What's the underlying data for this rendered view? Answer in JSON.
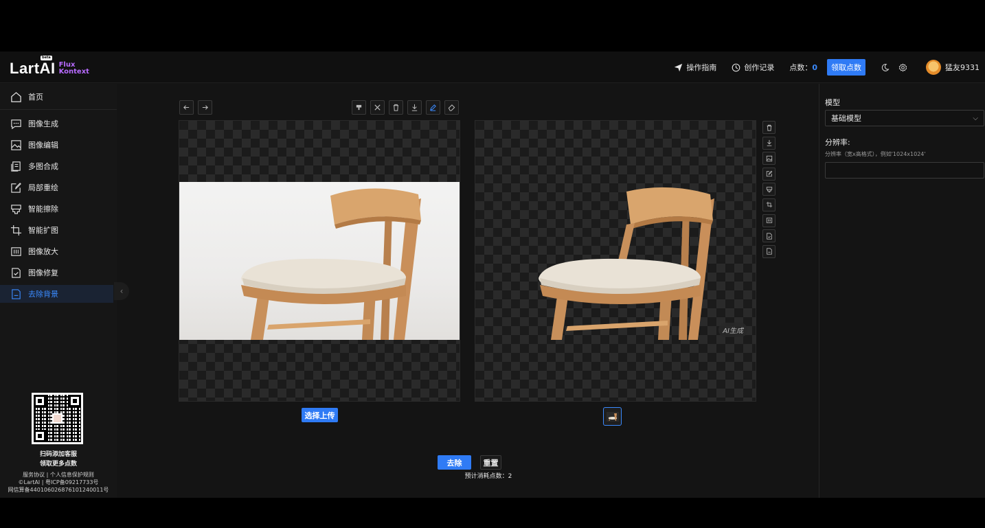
{
  "header": {
    "logo_text": "LartAI",
    "logo_badge": "beta",
    "logo_sub_line1": "Flux",
    "logo_sub_line2": "Kontext",
    "guide_label": "操作指南",
    "history_label": "创作记录",
    "points_label": "点数：",
    "points_value": "0",
    "claim_button": "领取点数",
    "username": "猛友9331"
  },
  "sidebar": {
    "items": [
      {
        "label": "首页",
        "icon": "home-icon"
      },
      {
        "label": "图像生成",
        "icon": "chat-icon"
      },
      {
        "label": "图像编辑",
        "icon": "image-icon"
      },
      {
        "label": "多图合成",
        "icon": "layers-icon"
      },
      {
        "label": "局部重绘",
        "icon": "edit-icon"
      },
      {
        "label": "智能擦除",
        "icon": "eraser-icon"
      },
      {
        "label": "智能扩图",
        "icon": "crop-icon"
      },
      {
        "label": "图像放大",
        "icon": "upscale-icon"
      },
      {
        "label": "图像修复",
        "icon": "repair-icon"
      },
      {
        "label": "去除背景",
        "icon": "remove-bg-icon"
      }
    ],
    "active_index": 9,
    "footer": {
      "qr_caption1": "扫码添加客服",
      "qr_caption2": "领取更多点数",
      "legal1": "服务协议 | 个人信息保护规则",
      "legal2": "©LartAI | 粤ICP备09217733号",
      "legal3": "网信算备440106026876101240011号"
    }
  },
  "editor": {
    "upload_button": "选择上传",
    "ai_badge": "AI生成",
    "remove_button": "去除",
    "reset_button": "重置",
    "estimate_label": "预计消耗点数：",
    "estimate_value": "2"
  },
  "right_panel": {
    "model_label": "模型",
    "model_value": "基础模型",
    "resolution_label": "分辨率:",
    "resolution_hint": "分辨率（宽x高格式），例如'1024x1024'",
    "resolution_value": ""
  },
  "colors": {
    "accent": "#2f7bf5",
    "background": "#141414",
    "logo_sub": "#b86bff"
  }
}
